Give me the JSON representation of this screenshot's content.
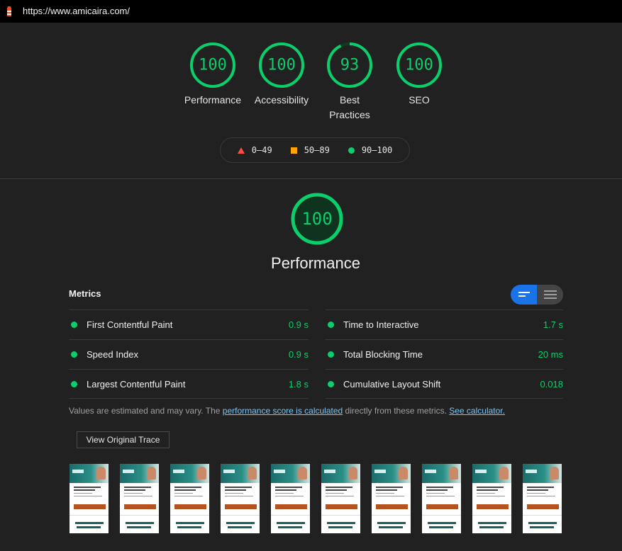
{
  "browser": {
    "url": "https://www.amicaira.com/"
  },
  "summary_gauges": [
    {
      "label": "Performance",
      "score": "100",
      "percent": 100
    },
    {
      "label": "Accessibility",
      "score": "100",
      "percent": 100
    },
    {
      "label": "Best Practices",
      "score": "93",
      "percent": 93
    },
    {
      "label": "SEO",
      "score": "100",
      "percent": 100
    }
  ],
  "legend": {
    "fail": "0–49",
    "average": "50–89",
    "pass": "90–100"
  },
  "colors": {
    "pass": "#0cce6b",
    "average": "#ffa400",
    "fail": "#ff4e42",
    "link": "#7cc4f4",
    "toggle_active": "#1a73e8"
  },
  "performance": {
    "score": "100",
    "percent": 100,
    "title": "Performance"
  },
  "metrics": {
    "heading": "Metrics",
    "left": [
      {
        "title": "First Contentful Paint",
        "value": "0.9 s"
      },
      {
        "title": "Speed Index",
        "value": "0.9 s"
      },
      {
        "title": "Largest Contentful Paint",
        "value": "1.8 s"
      }
    ],
    "right": [
      {
        "title": "Time to Interactive",
        "value": "1.7 s"
      },
      {
        "title": "Total Blocking Time",
        "value": "20 ms"
      },
      {
        "title": "Cumulative Layout Shift",
        "value": "0.018"
      }
    ]
  },
  "note": {
    "prefix": "Values are estimated and may vary. The ",
    "link1": "performance score is calculated",
    "middle": " directly from these metrics. ",
    "link2": "See calculator."
  },
  "trace_button": "View Original Trace",
  "filmstrip_frames": 10
}
